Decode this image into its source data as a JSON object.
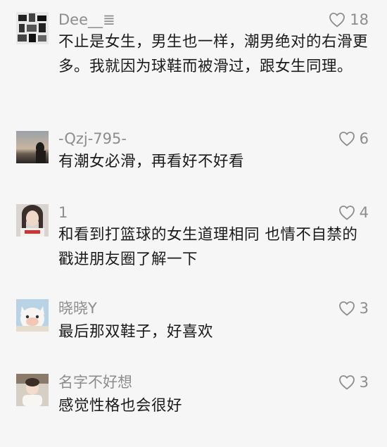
{
  "comments": [
    {
      "username": "Dee__≣",
      "likes": "18",
      "text": "不止是女生，男生也一样，潮男绝对的右滑更多。我就因为球鞋而被滑过，跟女生同理。"
    },
    {
      "username": "-Qzj-795-",
      "likes": "6",
      "text": "有潮女必滑，再看好不好看"
    },
    {
      "username": "1",
      "likes": "4",
      "text": "和看到打篮球的女生道理相同 也情不自禁的戳进朋友圈了解一下"
    },
    {
      "username": "晓晓Y",
      "likes": "3",
      "text": "最后那双鞋子，好喜欢"
    },
    {
      "username": "名字不好想",
      "likes": "3",
      "text": "感觉性格也会很好"
    }
  ],
  "icons": {
    "like": "heart-outline-icon"
  },
  "colors": {
    "background": "#f6f6f6",
    "meta": "#8d8d8d",
    "text": "#1a1a1a"
  }
}
